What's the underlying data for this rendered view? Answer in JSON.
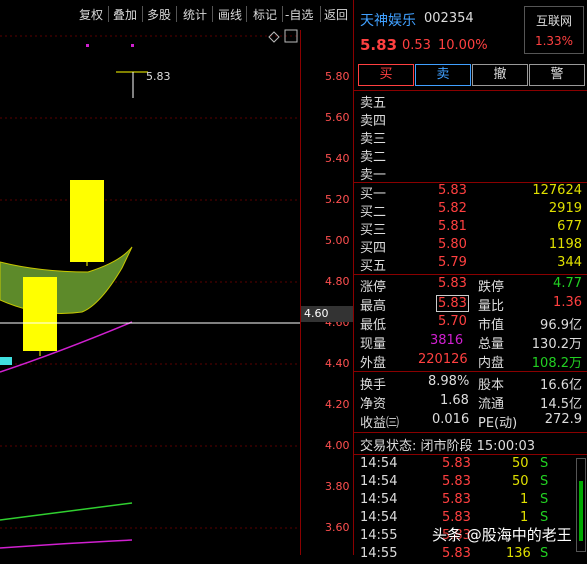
{
  "toolbar": {
    "items": [
      "复权",
      "叠加",
      "多股",
      "统计",
      "画线",
      "标记",
      "-自选",
      "返回"
    ]
  },
  "chart": {
    "price_axis": [
      "5.80",
      "5.60",
      "5.40",
      "5.20",
      "5.00",
      "4.80",
      "4.60",
      "4.40",
      "4.20",
      "4.00",
      "3.80",
      "3.60"
    ],
    "annotation_high": "5.83",
    "current_price_tag": "4.60"
  },
  "quote": {
    "name": "天神娱乐",
    "code": "002354",
    "sector": "互联网",
    "sector_change": "1.33%",
    "price": "5.83",
    "change": "0.53",
    "change_pct": "10.00%"
  },
  "trade_buttons": [
    "买",
    "卖",
    "撤",
    "警"
  ],
  "sell_levels": [
    {
      "label": "卖五",
      "price": "",
      "vol": ""
    },
    {
      "label": "卖四",
      "price": "",
      "vol": ""
    },
    {
      "label": "卖三",
      "price": "",
      "vol": ""
    },
    {
      "label": "卖二",
      "price": "",
      "vol": ""
    },
    {
      "label": "卖一",
      "price": "",
      "vol": ""
    }
  ],
  "buy_levels": [
    {
      "label": "买一",
      "price": "5.83",
      "vol": "127624"
    },
    {
      "label": "买二",
      "price": "5.82",
      "vol": "2919"
    },
    {
      "label": "买三",
      "price": "5.81",
      "vol": "677"
    },
    {
      "label": "买四",
      "price": "5.80",
      "vol": "1198"
    },
    {
      "label": "买五",
      "price": "5.79",
      "vol": "344"
    }
  ],
  "stats": {
    "limit_up_label": "涨停",
    "limit_up": "5.83",
    "limit_down_label": "跌停",
    "limit_down": "4.77",
    "high_label": "最高",
    "high": "5.83",
    "vol_ratio_label": "量比",
    "vol_ratio": "1.36",
    "low_label": "最低",
    "low": "5.70",
    "mkt_cap_label": "市值",
    "mkt_cap": "96.9亿",
    "cur_vol_label": "现量",
    "cur_vol": "3816",
    "total_vol_label": "总量",
    "total_vol": "130.2万",
    "outer_label": "外盘",
    "outer": "220126",
    "inner_label": "内盘",
    "inner": "108.2万",
    "turnover_label": "换手",
    "turnover": "8.98%",
    "shares_label": "股本",
    "shares": "16.6亿",
    "nav_label": "净资",
    "nav": "1.68",
    "float_label": "流通",
    "float": "14.5亿",
    "eps_label": "收益㈢",
    "eps": "0.016",
    "pe_label": "PE(动)",
    "pe": "272.9"
  },
  "status": "交易状态: 闭市阶段 15:00:03",
  "ticks": [
    {
      "time": "14:54",
      "price": "5.83",
      "vol": "50",
      "side": "S"
    },
    {
      "time": "14:54",
      "price": "5.83",
      "vol": "50",
      "side": "S"
    },
    {
      "time": "14:54",
      "price": "5.83",
      "vol": "1",
      "side": "S"
    },
    {
      "time": "14:54",
      "price": "5.83",
      "vol": "1",
      "side": "S"
    },
    {
      "time": "14:55",
      "price": "5.83",
      "vol": "",
      "side": ""
    },
    {
      "time": "14:55",
      "price": "5.83",
      "vol": "136",
      "side": "S"
    }
  ],
  "watermark": "头条 @股海中的老王"
}
